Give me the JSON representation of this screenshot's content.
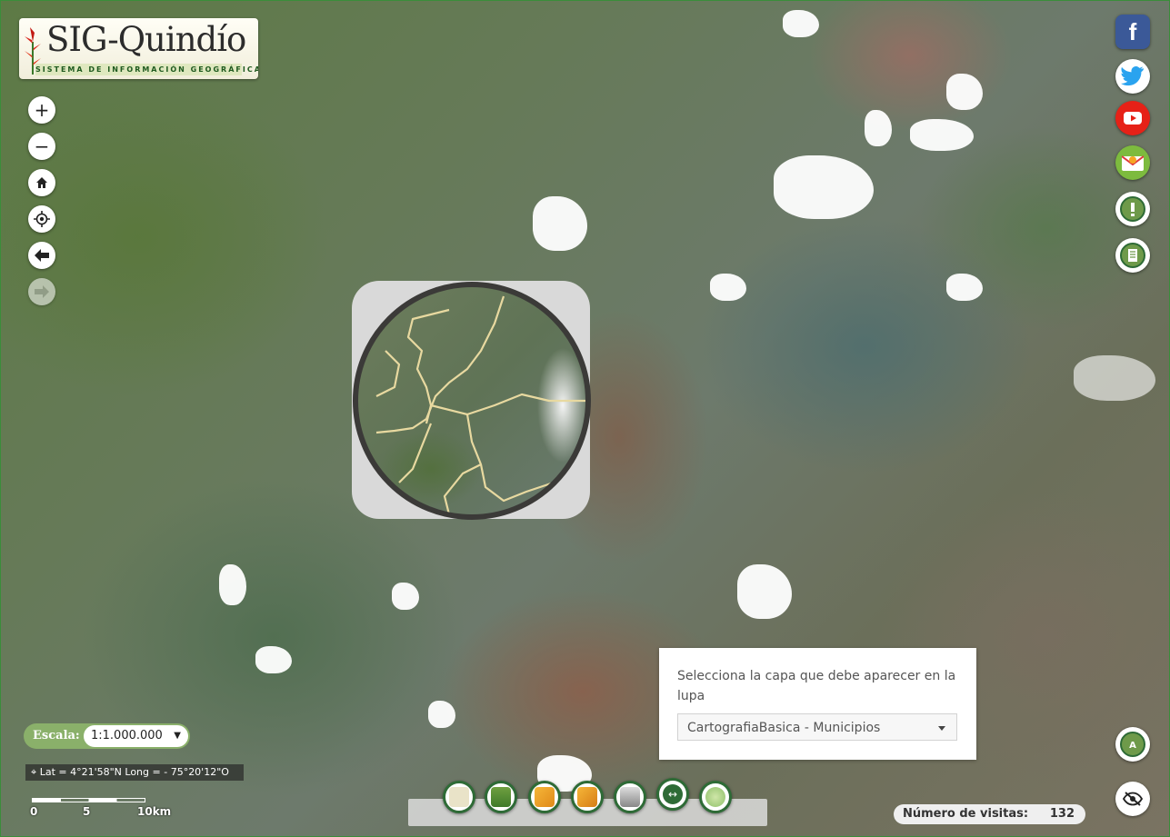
{
  "logo": {
    "title": "SIG-Quindío",
    "subtitle": "SISTEMA DE INFORMACIÓN GEOGRÁFICA"
  },
  "map_controls": {
    "zoom_in": "+",
    "zoom_out": "−",
    "home": "home-icon",
    "locate": "locate-icon",
    "back": "arrow-left-icon",
    "forward": "arrow-right-icon"
  },
  "social": {
    "facebook": "f",
    "items": [
      "facebook-icon",
      "twitter-icon",
      "youtube-icon",
      "email-icon",
      "help-icon",
      "manual-icon"
    ]
  },
  "magnifier_popup": {
    "prompt": "Selecciona la capa que debe aparecer en la lupa",
    "selected_layer": "CartografiaBasica - Municipios"
  },
  "scale": {
    "label": "Escala:",
    "value": "1:1.000.000"
  },
  "coordinates": {
    "text": "Lat = 4°21'58\"N Long = - 75°20'12\"O"
  },
  "scalebar": {
    "ticks": [
      "0",
      "5",
      "10km"
    ]
  },
  "visits": {
    "label": "Número de visitas:",
    "count": "132"
  },
  "colors": {
    "accent_green": "#2e6b36",
    "scale_green": "#8ab06a",
    "facebook": "#3b5998",
    "twitter": "#1da1f2",
    "youtube": "#e62117"
  }
}
